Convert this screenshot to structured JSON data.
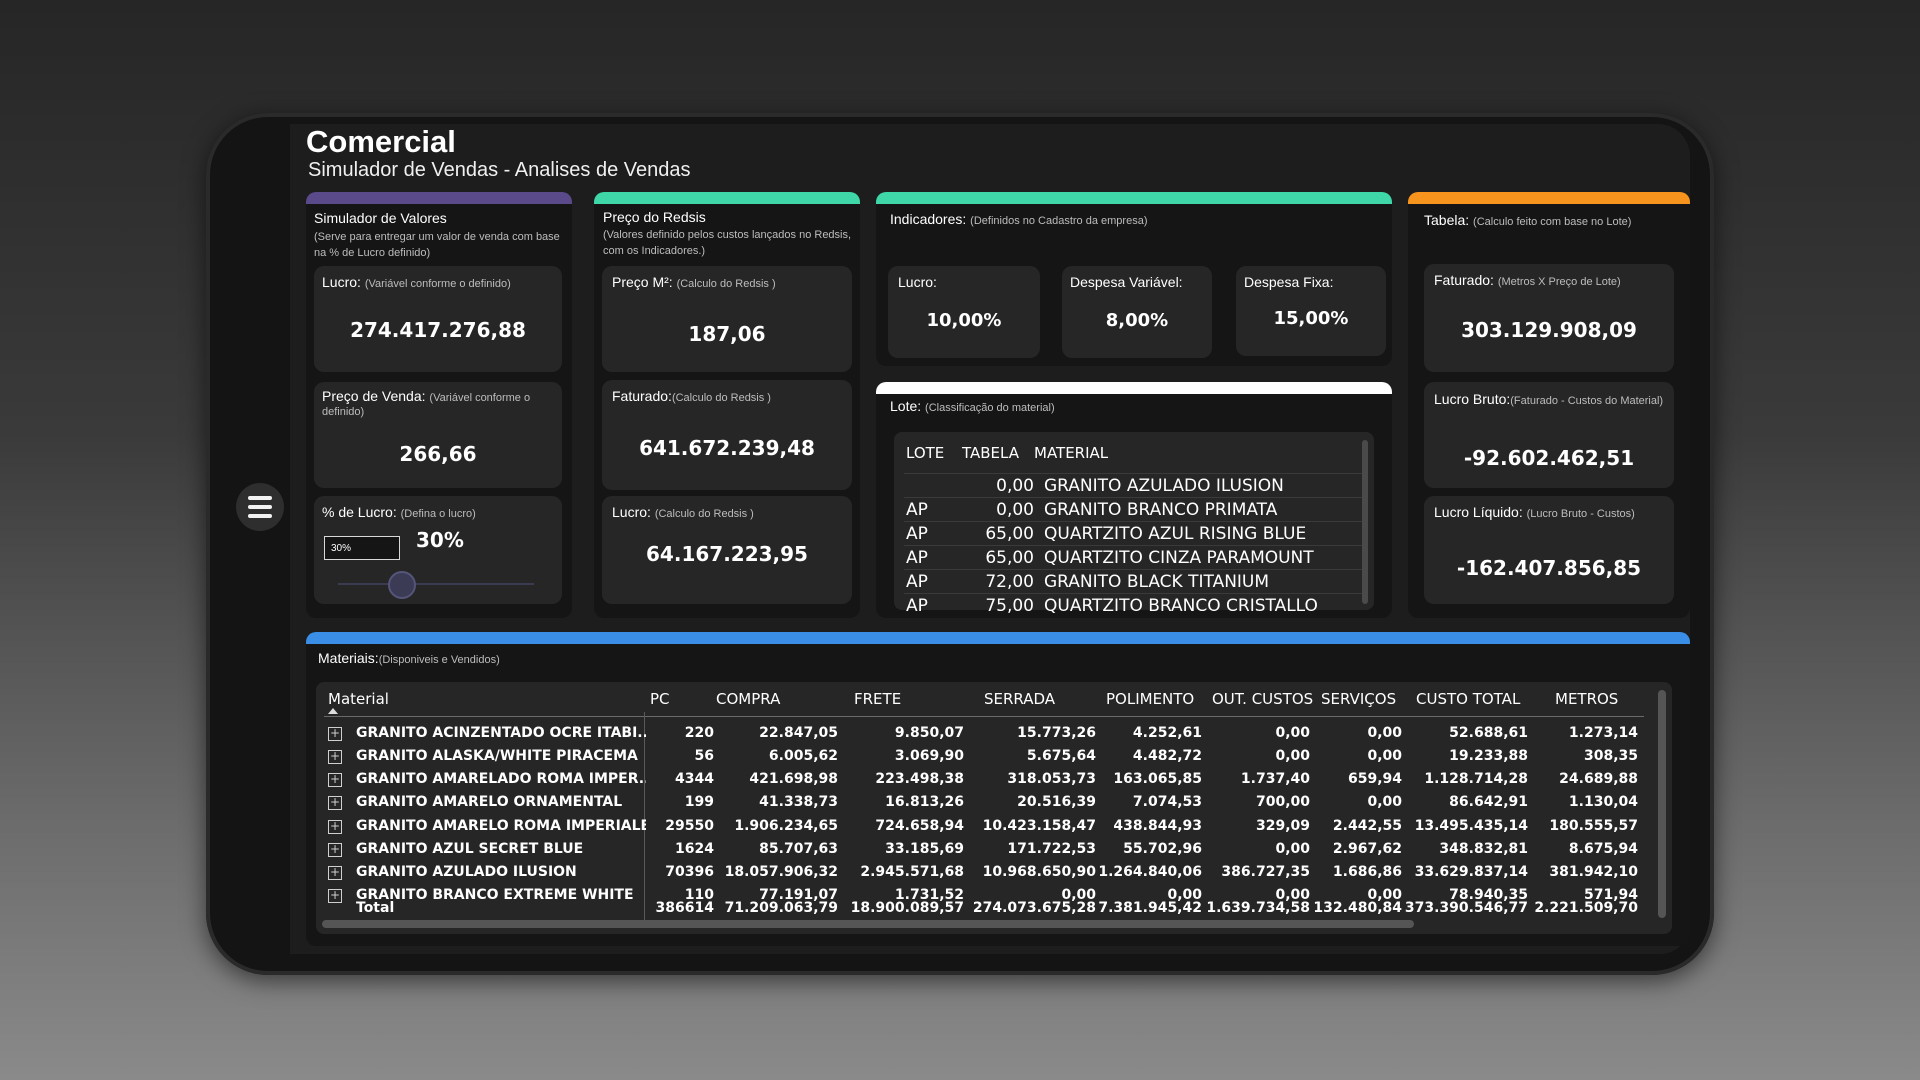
{
  "header": {
    "title": "Comercial",
    "subtitle": "Simulador de Vendas - Analises de Vendas"
  },
  "colors": {
    "purple": "#5a4a8a",
    "teal": "#3fd6a8",
    "orange": "#f7941d",
    "blue": "#3a8ee6",
    "white": "#ffffff"
  },
  "simulador": {
    "title": "Simulador de Valores",
    "desc": "(Serve para entregar um valor de venda com base na % de Lucro definido)",
    "lucro_label": "Lucro:",
    "lucro_note": "(Variável conforme o definido)",
    "lucro_value": "274.417.276,88",
    "preco_label": "Preço de Venda:",
    "preco_note": "(Variável conforme o definido)",
    "preco_value": "266,66",
    "pct_label": "% de Lucro:",
    "pct_note": "(Defina o lucro)",
    "pct_input": "30%",
    "pct_display": "30%",
    "slider_fraction": 0.3
  },
  "redsis": {
    "title": "Preço do Redsis",
    "desc": "(Valores definido pelos custos lançados no Redsis, com os Indicadores.)",
    "preco_label": "Preço M²:",
    "preco_note": "(Calculo do Redsis )",
    "preco_value": "187,06",
    "faturado_label": "Faturado:",
    "faturado_note": "(Calculo do Redsis )",
    "faturado_value": "641.672.239,48",
    "lucro_label": "Lucro:",
    "lucro_note": "(Calculo do Redsis )",
    "lucro_value": "64.167.223,95"
  },
  "indicadores": {
    "title": "Indicadores:",
    "note": "(Definidos no Cadastro da empresa)",
    "lucro_label": "Lucro:",
    "lucro_value": "10,00%",
    "desp_var_label": "Despesa Variável:",
    "desp_var_value": "8,00%",
    "desp_fixa_label": "Despesa Fixa:",
    "desp_fixa_value": "15,00%"
  },
  "lote": {
    "title": "Lote:",
    "note": "(Classificação do material)",
    "headers": [
      "LOTE",
      "TABELA",
      "MATERIAL"
    ],
    "rows": [
      [
        "",
        "0,00",
        "GRANITO AZULADO ILUSION"
      ],
      [
        "AP",
        "0,00",
        "GRANITO BRANCO PRIMATA"
      ],
      [
        "AP",
        "65,00",
        "QUARTZITO AZUL RISING BLUE"
      ],
      [
        "AP",
        "65,00",
        "QUARTZITO CINZA PARAMOUNT"
      ],
      [
        "AP",
        "72,00",
        "GRANITO BLACK TITANIUM"
      ],
      [
        "AP",
        "75,00",
        "QUARTZITO BRANCO CRISTALLO"
      ]
    ]
  },
  "tabela": {
    "title": "Tabela:",
    "note": "(Calculo feito com base no Lote)",
    "faturado_label": "Faturado:",
    "faturado_note": "(Metros X Preço de Lote)",
    "faturado_value": "303.129.908,09",
    "lucro_bruto_label": "Lucro Bruto:",
    "lucro_bruto_note": "(Faturado - Custos do Material)",
    "lucro_bruto_value": "-92.602.462,51",
    "lucro_liq_label": "Lucro Líquido:",
    "lucro_liq_note": "(Lucro Bruto - Custos)",
    "lucro_liq_value": "-162.407.856,85"
  },
  "materiais": {
    "title": "Materiais:",
    "note": "(Disponiveis e Vendidos)",
    "headers": [
      "Material",
      "PC",
      "COMPRA",
      "FRETE",
      "SERRADA",
      "POLIMENTO",
      "OUT. CUSTOS",
      "SERVIÇOS",
      "CUSTO TOTAL",
      "METROS"
    ],
    "rows": [
      [
        "GRANITO ACINZENTADO OCRE ITABI...",
        "220",
        "22.847,05",
        "9.850,07",
        "15.773,26",
        "4.252,61",
        "0,00",
        "0,00",
        "52.688,61",
        "1.273,14"
      ],
      [
        "GRANITO ALASKA/WHITE PIRACEMA",
        "56",
        "6.005,62",
        "3.069,90",
        "5.675,64",
        "4.482,72",
        "0,00",
        "0,00",
        "19.233,88",
        "308,35"
      ],
      [
        "GRANITO AMARELADO ROMA IMPER...",
        "4344",
        "421.698,98",
        "223.498,38",
        "318.053,73",
        "163.065,85",
        "1.737,40",
        "659,94",
        "1.128.714,28",
        "24.689,88"
      ],
      [
        "GRANITO AMARELO ORNAMENTAL",
        "199",
        "41.338,73",
        "16.813,26",
        "20.516,39",
        "7.074,53",
        "700,00",
        "0,00",
        "86.642,91",
        "1.130,04"
      ],
      [
        "GRANITO AMARELO ROMA IMPERIALE",
        "29550",
        "1.906.234,65",
        "724.658,94",
        "10.423.158,47",
        "438.844,93",
        "329,09",
        "2.442,55",
        "13.495.435,14",
        "180.555,57"
      ],
      [
        "GRANITO AZUL SECRET BLUE",
        "1624",
        "85.707,63",
        "33.185,69",
        "171.722,53",
        "55.702,96",
        "0,00",
        "2.967,62",
        "348.832,81",
        "8.675,94"
      ],
      [
        "GRANITO AZULADO ILUSION",
        "70396",
        "18.057.906,32",
        "2.945.571,68",
        "10.968.650,90",
        "1.264.840,06",
        "386.727,35",
        "1.686,86",
        "33.629.837,14",
        "381.942,10"
      ],
      [
        "GRANITO BRANCO EXTREME WHITE",
        "110",
        "77.191,07",
        "1.731,52",
        "0,00",
        "0,00",
        "0,00",
        "0,00",
        "78.940,35",
        "571,94"
      ]
    ],
    "total": [
      "Total",
      "386614",
      "71.209.063,79",
      "18.900.089,57",
      "274.073.675,28",
      "7.381.945,42",
      "1.639.734,58",
      "132.480,84",
      "373.390.546,77",
      "2.221.509,70"
    ]
  }
}
